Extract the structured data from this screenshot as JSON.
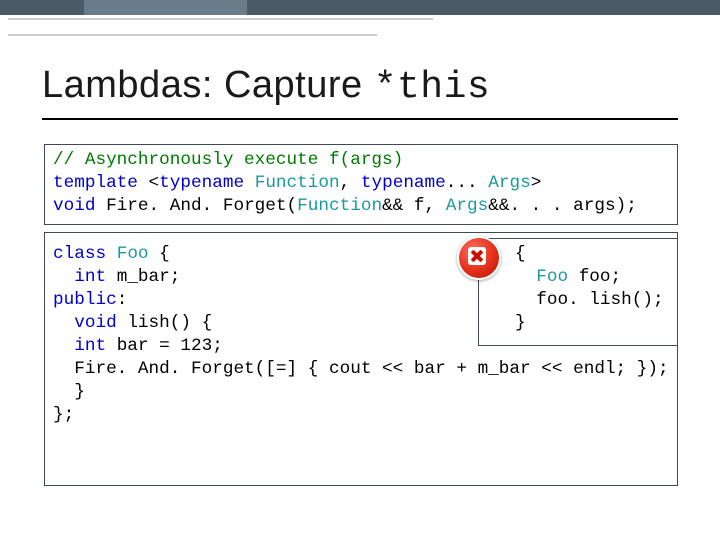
{
  "title_prefix": "Lambdas: Capture ",
  "title_mono": "*this",
  "code1": {
    "l1": "// Asynchronously execute f(args)",
    "l2a": "template",
    "l2b": " <",
    "l2c": "typename",
    "l2d": " ",
    "l2e": "Function",
    "l2f": ", ",
    "l2g": "typename",
    "l2h": "... ",
    "l2i": "Args",
    "l2j": ">",
    "l3a": "void",
    "l3b": " Fire. And. Forget(",
    "l3c": "Function",
    "l3d": "&& f, ",
    "l3e": "Args",
    "l3f": "&&. . . args);"
  },
  "code2": {
    "l1a": "class",
    "l1b": " ",
    "l1c": "Foo",
    "l1d": " {",
    "l2a": "  ",
    "l2b": "int",
    "l2c": " m_bar;",
    "l3a": "public",
    "l3b": ":",
    "l4a": "  ",
    "l4b": "void",
    "l4c": " lish() {",
    "l5a": "  ",
    "l5b": "int",
    "l5c": " bar = 123;",
    "l6": "  Fire. And. Forget([=] { cout << bar + m_bar << endl; });",
    "l7": "  }",
    "l8": "};"
  },
  "side": {
    "l1": "{",
    "l2a": "  ",
    "l2b": "Foo",
    "l2c": " foo;",
    "l3": "  foo. lish();",
    "l4": "}"
  }
}
